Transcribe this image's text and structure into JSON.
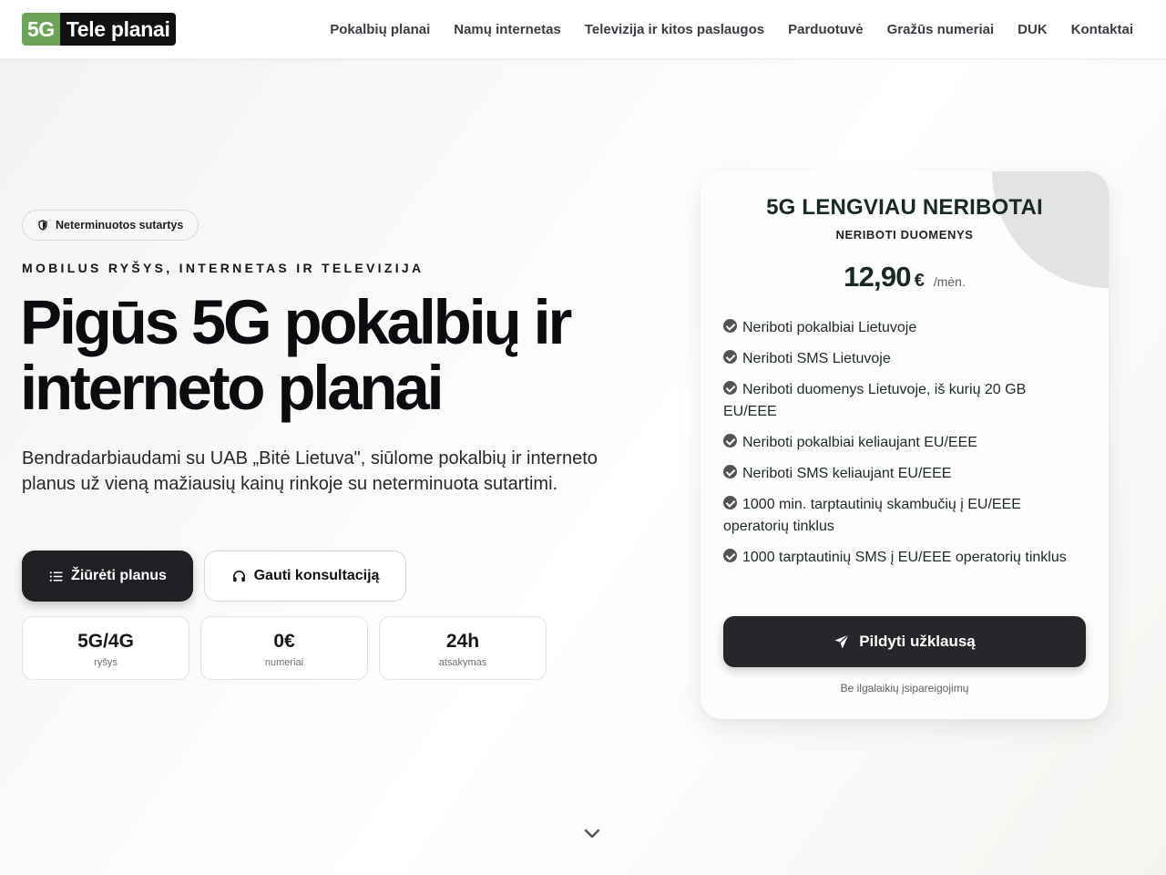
{
  "brand": {
    "logo_5g": "5G",
    "logo_name": "Tele planai",
    "accent": "#6fa35a"
  },
  "nav": {
    "items": [
      {
        "label": "Pokalbių planai"
      },
      {
        "label": "Namų internetas"
      },
      {
        "label": "Televizija ir kitos paslaugos"
      },
      {
        "label": "Parduotuvė"
      },
      {
        "label": "Gražūs numeriai"
      },
      {
        "label": "DUK"
      },
      {
        "label": "Kontaktai"
      }
    ]
  },
  "hero": {
    "badge": {
      "icon": "shield-icon",
      "label": "Neterminuotos sutartys"
    },
    "eyebrow": "MOBILUS RYŠYS, INTERNETAS IR TELEVIZIJA",
    "headline": "Pigūs 5G pokalbių ir interneto planai",
    "subtitle": "Bendradarbiaudami su UAB „Bitė Lietuva\", siūlome pokalbių ir interneto planus už vieną mažiausių kainų rinkoje su neterminuota sutartimi.",
    "primary_button": {
      "icon": "list-icon",
      "label": "Žiūrėti planus"
    },
    "secondary_button": {
      "icon": "headset-icon",
      "label": "Gauti konsultaciją"
    },
    "stats": [
      {
        "value": "5G/4G",
        "label": "ryšys"
      },
      {
        "value": "0€",
        "label": "numeriai"
      },
      {
        "value": "24h",
        "label": "atsakymas"
      }
    ]
  },
  "plan_card": {
    "title": "5G LENGVIAU NERIBOTAI",
    "subtitle": "NERIBOTI DUOMENYS",
    "price": "12,90",
    "currency": "€",
    "period": "/mėn.",
    "features": [
      "Neriboti pokalbiai Lietuvoje",
      "Neriboti SMS Lietuvoje",
      "Neriboti duomenys Lietuvoje, iš kurių 20 GB EU/EEE",
      "Neriboti pokalbiai keliaujant EU/EEE",
      "Neriboti SMS keliaujant EU/EEE",
      "1000 min. tarptautinių skambučių į EU/EEE operatorių tinklus",
      "1000 tarptautinių SMS į EU/EEE operatorių tinklus"
    ],
    "feature_icon": "check-circle-icon",
    "button": {
      "icon": "send-icon",
      "label": "Pildyti užklausą"
    },
    "note": "Be ilgalaikių įsipareigojimų"
  },
  "scroll_indicator": {
    "icon": "chevron-down-icon"
  }
}
